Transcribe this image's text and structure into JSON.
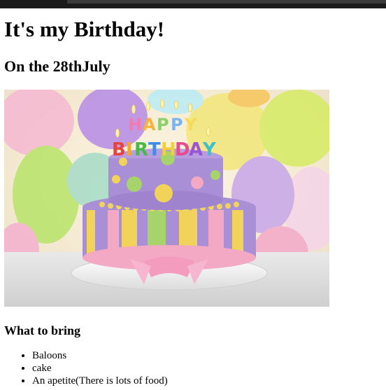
{
  "page": {
    "heading": "It's my Birthday!",
    "subheading": "On the 28thJuly",
    "section_title": "What to bring",
    "items": [
      "Baloons",
      "cake",
      "An apetite(There is lots of food)"
    ]
  },
  "image": {
    "subject": "birthday-cake-photo",
    "colors": {
      "cake_purple": "#a98fd6",
      "ribbon_pink": "#f3a8c4",
      "stripe_yellow": "#f2d35a",
      "stripe_green": "#a6d46a"
    }
  }
}
